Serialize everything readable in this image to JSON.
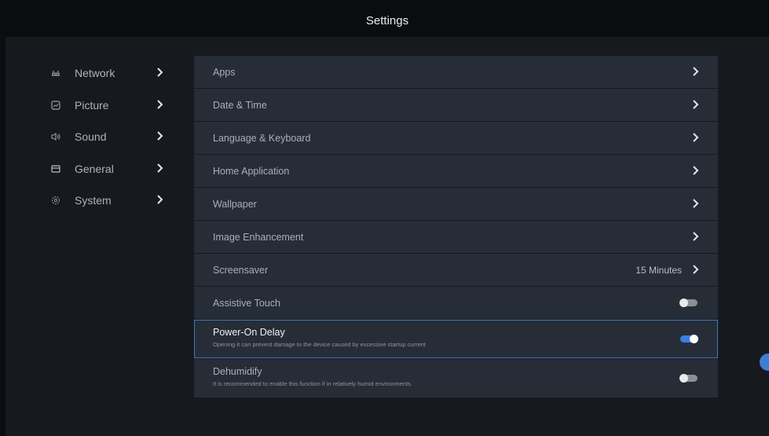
{
  "header": {
    "title": "Settings"
  },
  "sidebar": {
    "items": [
      {
        "label": "Network",
        "icon": "network-icon"
      },
      {
        "label": "Picture",
        "icon": "picture-icon"
      },
      {
        "label": "Sound",
        "icon": "sound-icon"
      },
      {
        "label": "General",
        "icon": "general-icon"
      },
      {
        "label": "System",
        "icon": "system-icon"
      }
    ]
  },
  "main": {
    "items": [
      {
        "label": "Apps"
      },
      {
        "label": "Date & Time"
      },
      {
        "label": "Language & Keyboard"
      },
      {
        "label": "Home Application"
      },
      {
        "label": "Wallpaper"
      },
      {
        "label": "Image Enhancement"
      },
      {
        "label": "Screensaver",
        "value": "15 Minutes"
      },
      {
        "label": "Assistive Touch",
        "toggle": "off"
      },
      {
        "label": "Power-On Delay",
        "subtitle": "Opening it can prevent damage to the device caused by excessive startup current",
        "toggle": "on"
      },
      {
        "label": "Dehumidify",
        "subtitle": "It is recommended to enable this function if in relatively humid environments.",
        "toggle": "off"
      }
    ]
  },
  "floating_button": {
    "icon": "assistive-touch-icon"
  },
  "colors": {
    "accent": "#3a7fe0",
    "row_bg": "#272d36",
    "bg": "#16191e",
    "title_bar": "#0b0c0e"
  }
}
